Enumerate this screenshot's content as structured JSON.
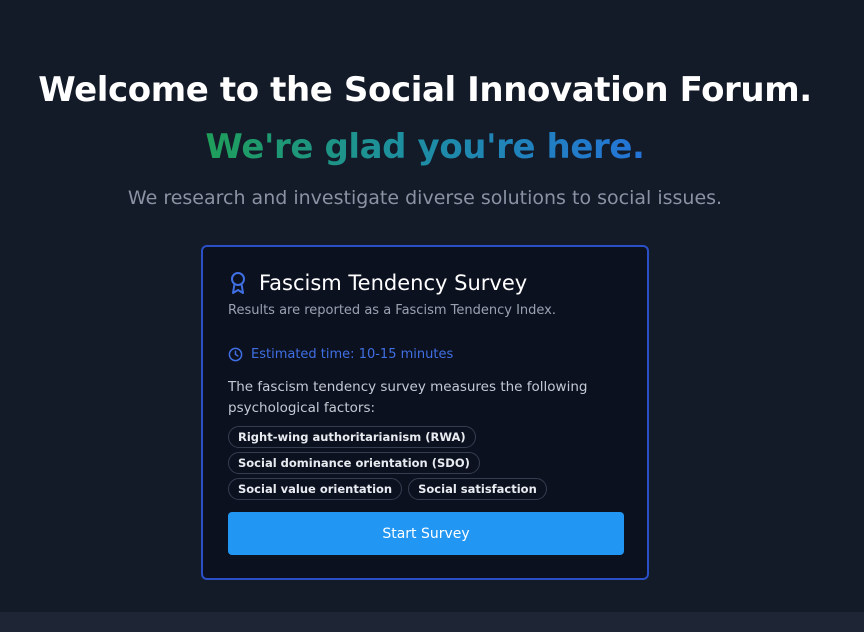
{
  "hero": {
    "title": "Welcome to the Social Innovation Forum.",
    "subtitle": "We're glad you're here.",
    "tagline": "We research and investigate diverse solutions to social issues."
  },
  "survey_card": {
    "icon": "award-ribbon-icon",
    "title": "Fascism Tendency Survey",
    "description": "Results are reported as a Fascism Tendency Index.",
    "time_icon": "clock-icon",
    "estimated_time": "Estimated time: 10-15 minutes",
    "factors_intro": "The fascism tendency survey measures the following psychological factors:",
    "factors": [
      "Right-wing authoritarianism (RWA)",
      "Social dominance orientation (SDO)",
      "Social value orientation",
      "Social satisfaction"
    ],
    "start_button": "Start Survey"
  },
  "colors": {
    "background": "#131a28",
    "card_border": "#2a4fc7",
    "accent_blue": "#2196f3",
    "gradient_start": "#1f9e5a",
    "gradient_end": "#2474d8"
  }
}
